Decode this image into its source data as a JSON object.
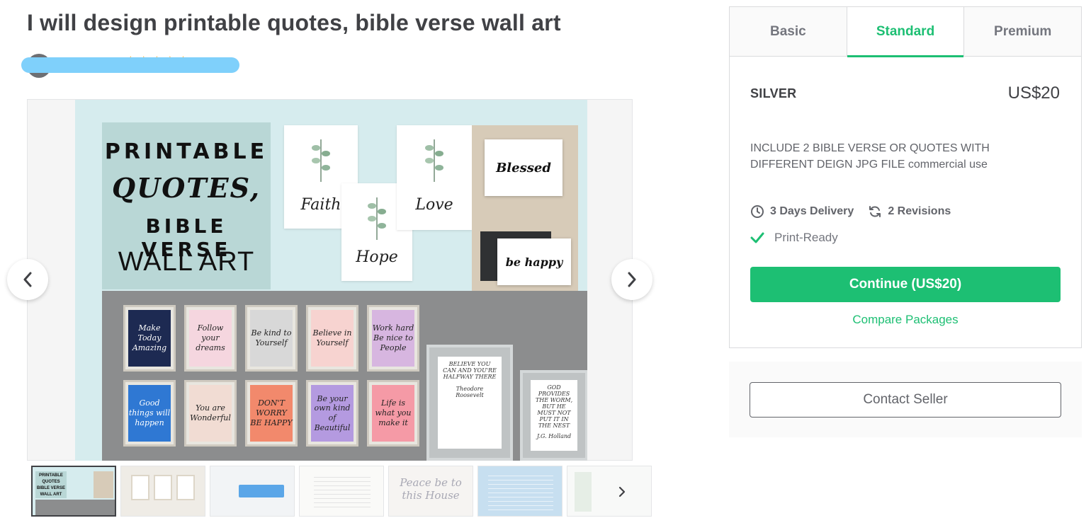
{
  "gig": {
    "title": "I will design printable quotes, bible verse wall art"
  },
  "seller": {
    "stars": "★★★★★"
  },
  "gallery": {
    "main_image": {
      "hero_lines": [
        "PRINTABLE",
        "QUOTES,",
        "BIBLE VERSE",
        "WALL ART"
      ],
      "cards": [
        "Faith",
        "Hope",
        "Love"
      ],
      "envelopes": [
        "Blessed",
        "be happy"
      ],
      "frames_top": [
        "Make Today Amazing",
        "Follow your dreams",
        "Be kind to Yourself",
        "Believe in Yourself",
        "Work hard Be nice to People"
      ],
      "frames_bottom": [
        "Good things will happen",
        "You are Wonderful",
        "DON'T WORRY BE HAPPY",
        "Be your own kind of Beautiful",
        "Life is what you make it"
      ],
      "big_frames": [
        {
          "text": "BELIEVE YOU CAN AND YOU'RE HALFWAY THERE",
          "author": "Theodore Roosevelt"
        },
        {
          "text": "GOD PROVIDES THE WORM, BUT HE MUST NOT PUT IT IN THE NEST",
          "author": "J.G. Holland"
        }
      ]
    },
    "thumbnails": [
      {
        "label": "PRINTABLE QUOTES BIBLE VERSE WALL ART"
      },
      {
        "label": ""
      },
      {
        "label": ""
      },
      {
        "label": ""
      },
      {
        "label": "Peace be to this House"
      },
      {
        "label": ""
      },
      {
        "label": ""
      }
    ]
  },
  "package": {
    "tabs": [
      "Basic",
      "Standard",
      "Premium"
    ],
    "active_tab": "Standard",
    "name": "SILVER",
    "price": "US$20",
    "description": "INCLUDE 2 BIBLE VERSE OR QUOTES WITH DIFFERENT DEIGN JPG FILE commercial use",
    "delivery": "3 Days Delivery",
    "revisions": "2 Revisions",
    "features": [
      "Print-Ready"
    ],
    "continue_label": "Continue (US$20)",
    "compare_label": "Compare Packages"
  },
  "contact": {
    "button_label": "Contact Seller"
  },
  "colors": {
    "accent": "#1dbf73",
    "text": "#404145",
    "muted": "#74767e",
    "redaction": "#7fd0fb",
    "star": "#ffb33e"
  },
  "icons": {
    "prev": "chevron-left-icon",
    "next": "chevron-right-icon",
    "delivery": "clock-icon",
    "revisions": "refresh-icon",
    "feature": "check-icon"
  }
}
